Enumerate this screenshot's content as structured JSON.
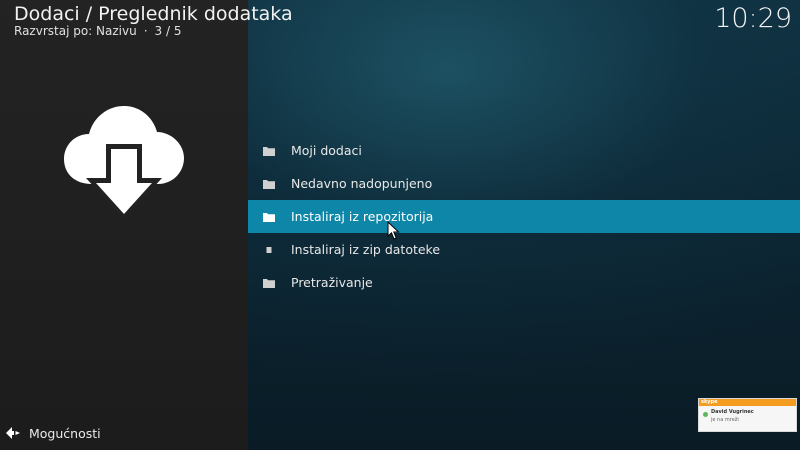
{
  "header": {
    "title": "Dodaci / Preglednik dodataka",
    "sort_label": "Razvrstaj po: Nazivu",
    "separator": "·",
    "position": "3 / 5"
  },
  "clock": "10:29",
  "art": {
    "icon": "cloud-download-icon"
  },
  "menu": {
    "selected_index": 2,
    "items": [
      {
        "label": "Moji dodaci",
        "icon": "folder-icon"
      },
      {
        "label": "Nedavno nadopunjeno",
        "icon": "folder-icon"
      },
      {
        "label": "Instaliraj iz repozitorija",
        "icon": "folder-icon"
      },
      {
        "label": "Instaliraj iz zip datoteke",
        "icon": "file-icon"
      },
      {
        "label": "Pretraživanje",
        "icon": "folder-icon"
      }
    ]
  },
  "options": {
    "label": "Mogućnosti",
    "icon": "options-arrows-icon"
  },
  "notification": {
    "brand": "skype",
    "name": "David Vugrinec",
    "message": "je na mreži",
    "accent": "#f39c1f"
  },
  "colors": {
    "selection": "#0e86a8"
  }
}
